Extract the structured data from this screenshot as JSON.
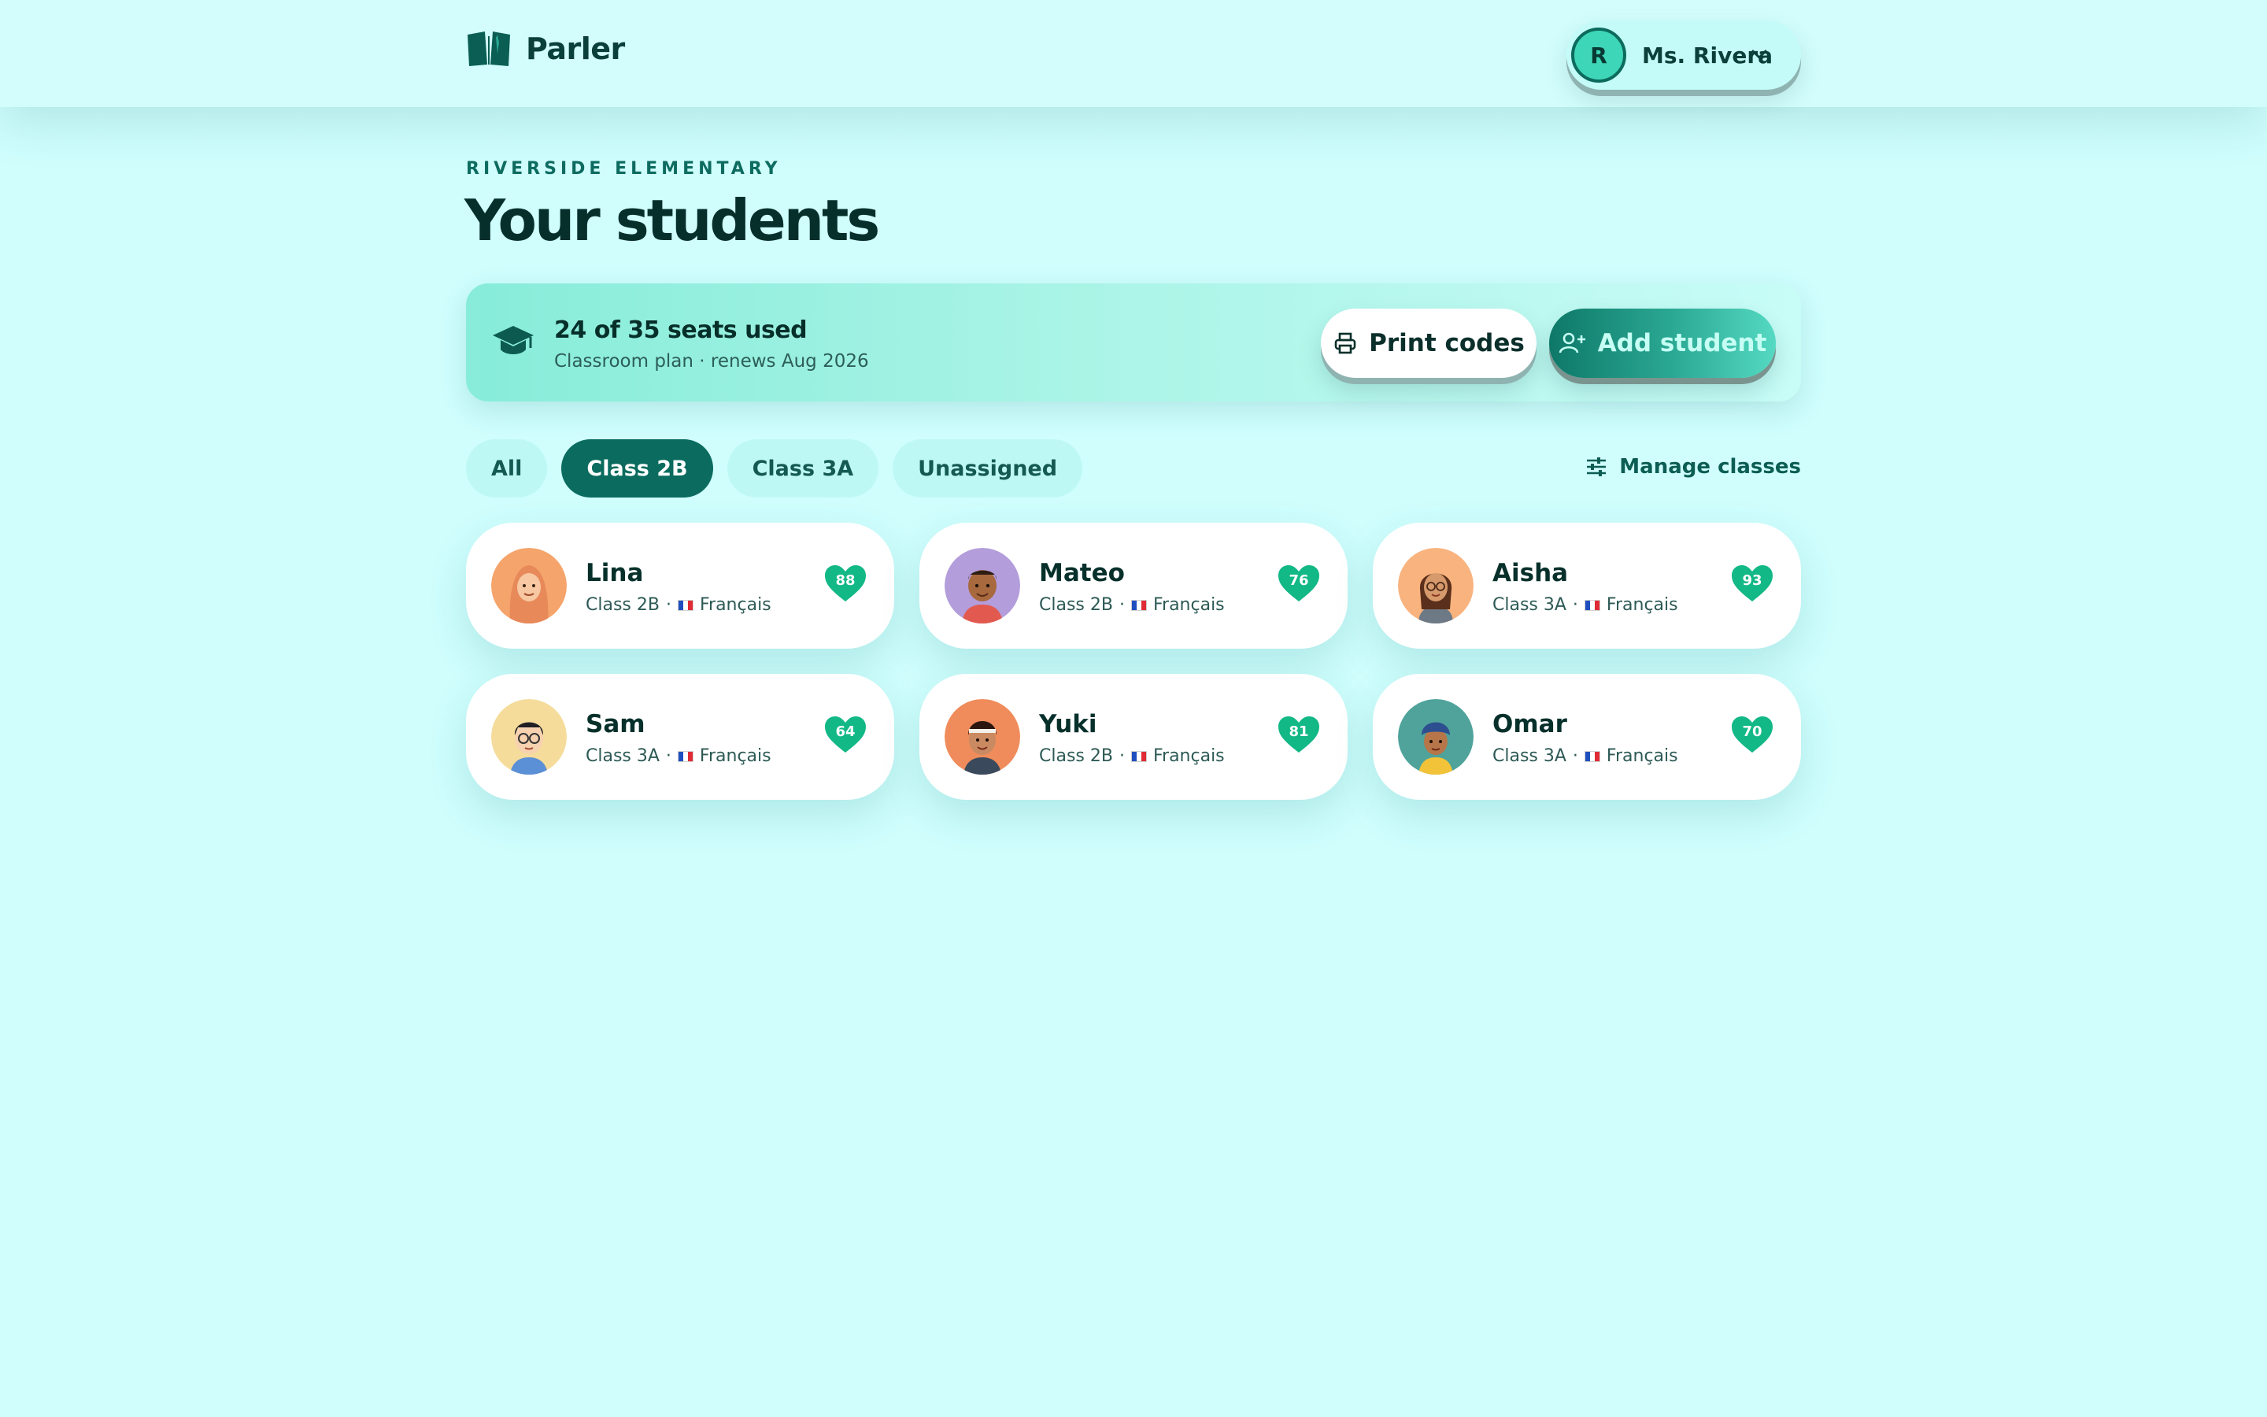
{
  "app": {
    "brand_name": "Parler",
    "user": {
      "initial": "R",
      "name": "Ms. Rivera"
    }
  },
  "header": {
    "eyebrow": "RIVERSIDE ELEMENTARY",
    "title": "Your students"
  },
  "seats": {
    "title": "24 of 35 seats used",
    "subtitle": "Classroom plan · renews Aug 2026",
    "print_label": "Print codes",
    "add_label": "Add student"
  },
  "filters": {
    "tabs": [
      {
        "label": "All",
        "active": false
      },
      {
        "label": "Class 2B",
        "active": true
      },
      {
        "label": "Class 3A",
        "active": false
      },
      {
        "label": "Unassigned",
        "active": false
      }
    ],
    "manage_label": "Manage classes"
  },
  "students": [
    {
      "name": "Lina",
      "class": "Class 2B",
      "language": "Français",
      "score": "88",
      "avatar_bg": "#f5a46b"
    },
    {
      "name": "Mateo",
      "class": "Class 2B",
      "language": "Français",
      "score": "76",
      "avatar_bg": "#b39ddb"
    },
    {
      "name": "Aisha",
      "class": "Class 3A",
      "language": "Français",
      "score": "93",
      "avatar_bg": "#f9b37e"
    },
    {
      "name": "Sam",
      "class": "Class 3A",
      "language": "Français",
      "score": "64",
      "avatar_bg": "#f5dc9b"
    },
    {
      "name": "Yuki",
      "class": "Class 2B",
      "language": "Français",
      "score": "81",
      "avatar_bg": "#f08c5b"
    },
    {
      "name": "Omar",
      "class": "Class 3A",
      "language": "Français",
      "score": "70",
      "avatar_bg": "#4fa39b"
    }
  ],
  "colors": {
    "background": "#cffefd",
    "primary": "#0a6b5e",
    "heart": "#12b886"
  }
}
